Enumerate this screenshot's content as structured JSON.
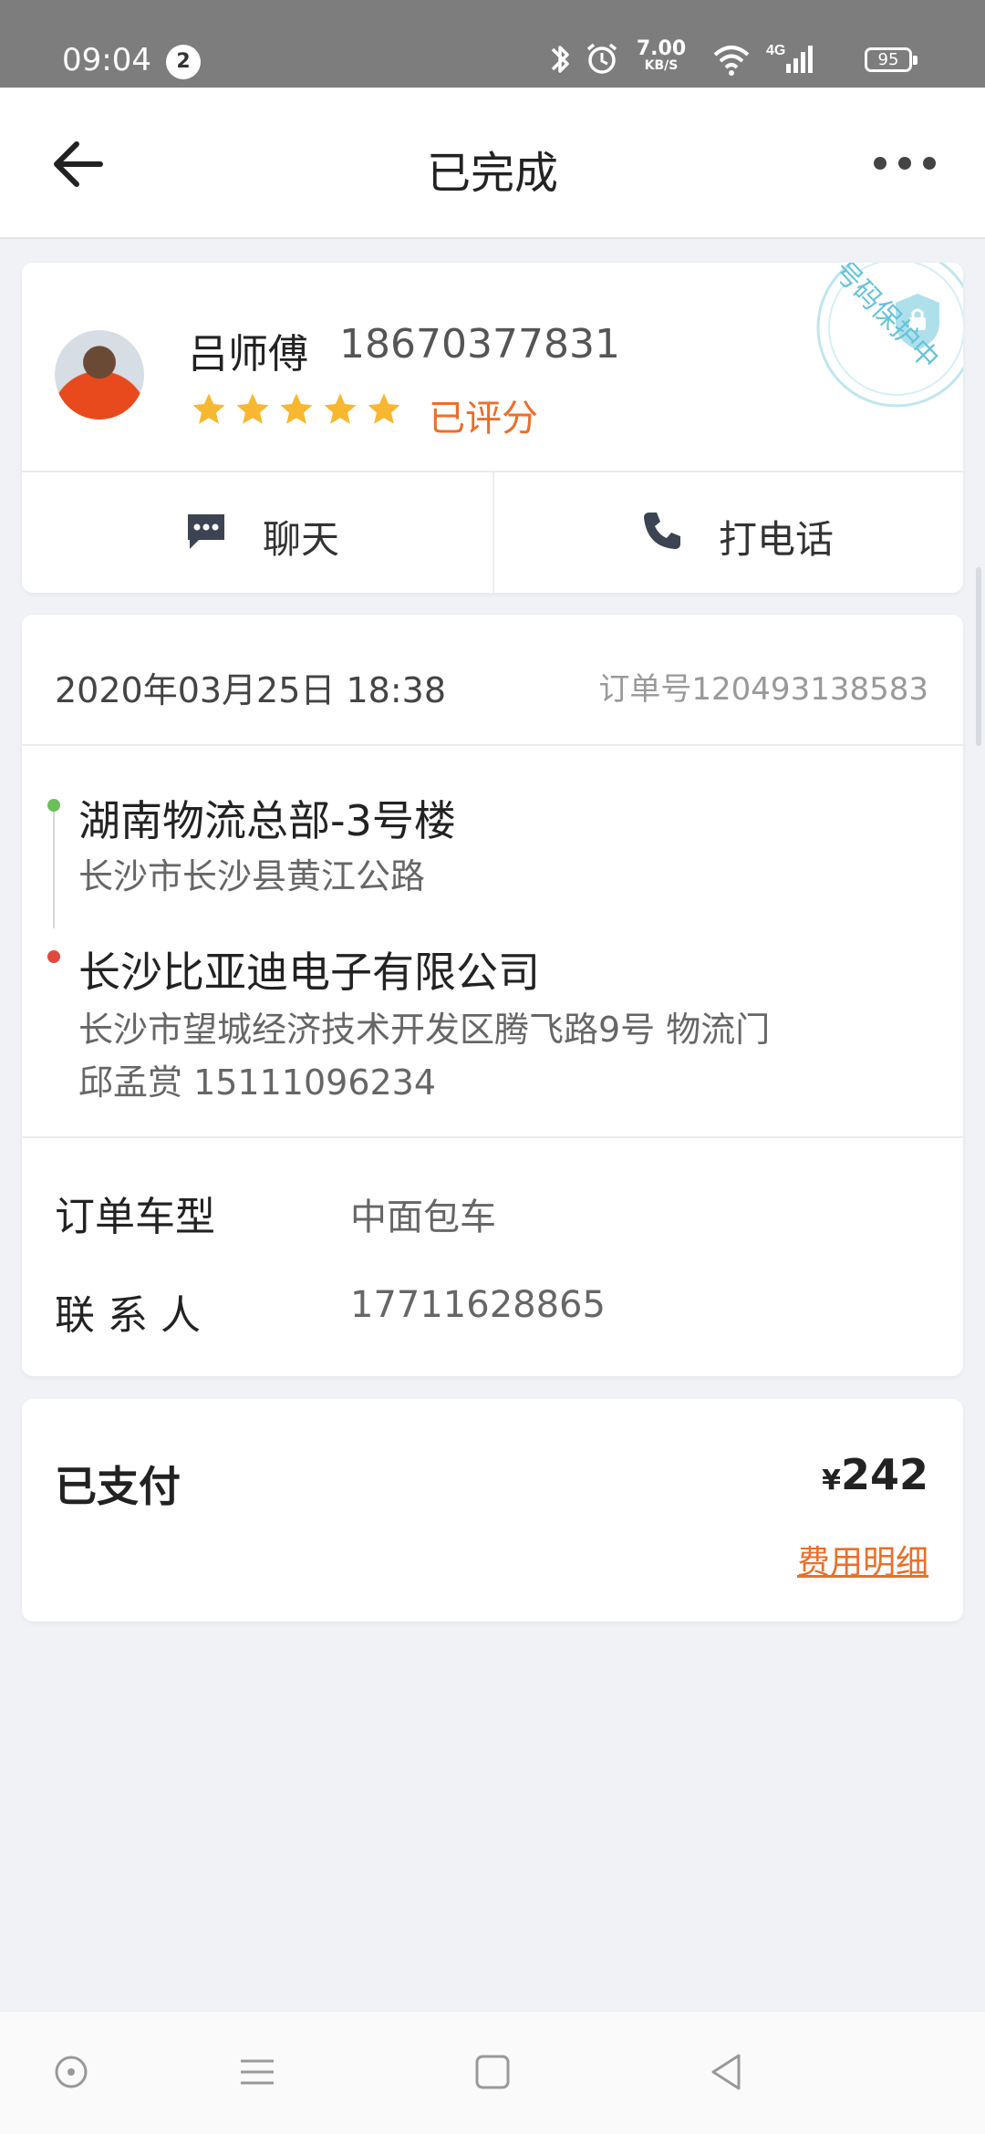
{
  "status_bar": {
    "time": "09:04",
    "notification_count": "2",
    "net_speed": "7.00",
    "net_speed_unit": "KB/S",
    "battery": "95",
    "icons": [
      "bluetooth-icon",
      "alarm-icon",
      "wifi-icon",
      "signal-4g-icon",
      "battery-icon"
    ]
  },
  "header": {
    "title": "已完成",
    "back_icon": "arrow-left-icon",
    "more_icon": "more-horizontal-icon"
  },
  "driver": {
    "name": "吕师傅",
    "phone": "18670377831",
    "rating_stars": 5,
    "rating_status": "已评分",
    "protection_badge": "号码保护中",
    "chat_label": "聊天",
    "call_label": "打电话"
  },
  "order": {
    "datetime": "2020年03月25日 18:38",
    "order_number": "订单号120493138583",
    "pickup": {
      "name": "湖南物流总部-3号楼",
      "address": "长沙市长沙县黄江公路"
    },
    "dropoff": {
      "name": "长沙比亚迪电子有限公司",
      "address": "长沙市望城经济技术开发区腾飞路9号 物流门",
      "contact": "邱孟赏 15111096234"
    },
    "vehicle_label": "订单车型",
    "vehicle_value": "中面包车",
    "contact_label": "联 系 人",
    "contact_value": "17711628865"
  },
  "payment": {
    "status": "已支付",
    "currency": "¥",
    "amount": "242",
    "details_link": "费用明细"
  },
  "colors": {
    "accent": "#e96f2c",
    "star": "#f7b731",
    "pickup_dot": "#6bbf58",
    "dropoff_dot": "#e0493e",
    "background": "#f0f2f5"
  }
}
